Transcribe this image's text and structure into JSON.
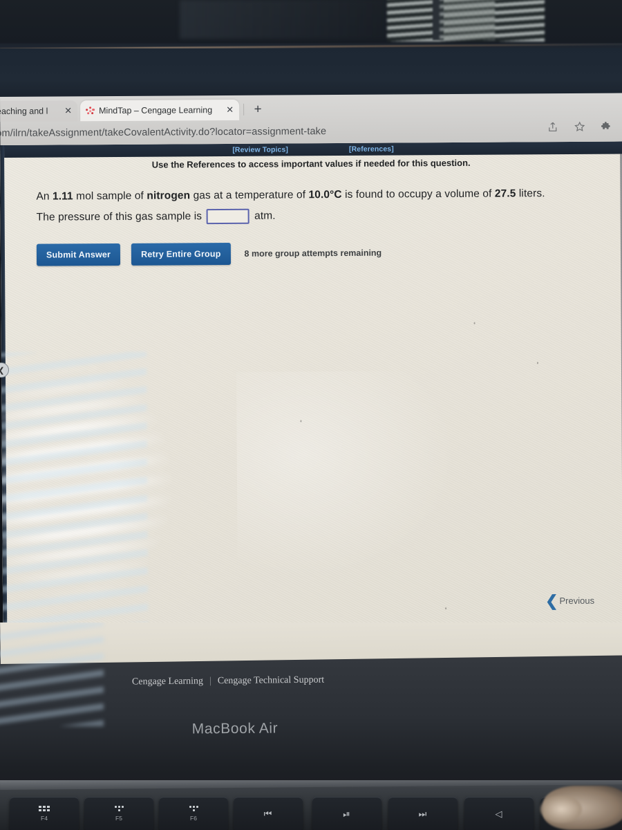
{
  "browser": {
    "tabs": [
      {
        "title": "ne teaching and l",
        "favicon": "none",
        "active": false,
        "close_label": "✕"
      },
      {
        "title": "MindTap – Cengage Learning",
        "favicon": "mindtap-dots",
        "active": true,
        "close_label": "✕"
      }
    ],
    "new_tab_label": "+",
    "url": "om/ilrn/takeAssignment/takeCovalentActivity.do?locator=assignment-take",
    "toolbar_icons": [
      "share-icon",
      "bookmark-star-icon",
      "extensions-puzzle-icon"
    ]
  },
  "page": {
    "topbar": {
      "review_topics": "[Review Topics]",
      "references": "[References]"
    },
    "hint": "Use the References to access important values if needed for this question.",
    "question": {
      "line1_parts": [
        {
          "t": "An ",
          "b": false
        },
        {
          "t": "1.11",
          "b": true
        },
        {
          "t": " mol sample of ",
          "b": false
        },
        {
          "t": "nitrogen",
          "b": true
        },
        {
          "t": " gas at a temperature of ",
          "b": false
        },
        {
          "t": "10.0°C",
          "b": true
        },
        {
          "t": " is found to occupy a volume of ",
          "b": false
        },
        {
          "t": "27.5",
          "b": true
        },
        {
          "t": " liters.",
          "b": false
        }
      ],
      "line2_prefix": "The pressure of this gas sample is",
      "answer_value": "",
      "answer_placeholder": "",
      "unit": "atm."
    },
    "buttons": {
      "submit": "Submit Answer",
      "retry": "Retry Entire Group"
    },
    "attempts": "8 more group attempts remaining",
    "previous": "Previous",
    "side_handle_icon": "chevron-left-icon"
  },
  "footer": {
    "brand": "Cengage Learning",
    "separator": "|",
    "support": "Cengage Technical Support"
  },
  "device": {
    "model": "MacBook Air",
    "keys": [
      {
        "name": "F4",
        "glyph": "grid"
      },
      {
        "name": "F5",
        "glyph": "backlight-down"
      },
      {
        "name": "F6",
        "glyph": "backlight-up"
      },
      {
        "name": "",
        "glyph": "⏮"
      },
      {
        "name": "",
        "glyph": "⏯"
      },
      {
        "name": "",
        "glyph": "⏭"
      },
      {
        "name": "",
        "glyph": "◁"
      }
    ]
  },
  "colors": {
    "accent_blue": "#1d5792",
    "link_blue": "#7fb6e8",
    "page_bg": "#e7e3d9",
    "topbar_navy": "#1d2734",
    "input_border": "#5b63ad"
  }
}
